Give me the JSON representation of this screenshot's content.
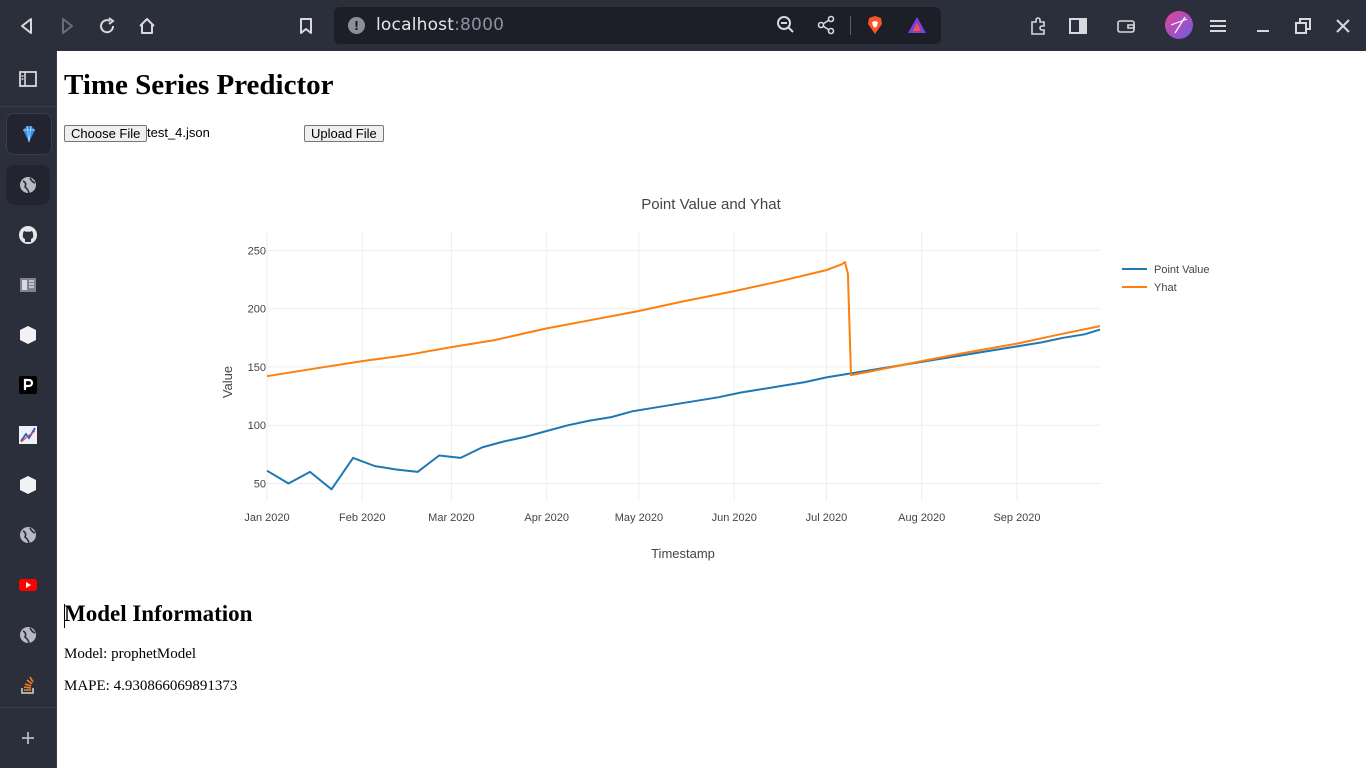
{
  "browser": {
    "url_host": "localhost",
    "url_port": ":8000"
  },
  "page": {
    "title": "Time Series Predictor",
    "choose_file_label": "Choose File",
    "file_name": "test_4.json",
    "upload_label": "Upload File"
  },
  "chart_data": {
    "type": "line",
    "title": "Point Value and Yhat",
    "xlabel": "Timestamp",
    "ylabel": "Value",
    "x_ticks": [
      "Jan 2020",
      "Feb 2020",
      "Mar 2020",
      "Apr 2020",
      "May 2020",
      "Jun 2020",
      "Jul 2020",
      "Aug 2020",
      "Sep 2020"
    ],
    "y_ticks": [
      50,
      100,
      150,
      200,
      250
    ],
    "x_range": [
      "2020-01-01",
      "2020-09-28"
    ],
    "y_range": [
      35,
      258
    ],
    "grid": true,
    "legend_position": "top-right",
    "series": [
      {
        "name": "Point Value",
        "color": "#1f77b4",
        "points": [
          [
            "2020-01-01",
            61
          ],
          [
            "2020-01-08",
            50
          ],
          [
            "2020-01-15",
            60
          ],
          [
            "2020-01-22",
            45
          ],
          [
            "2020-01-29",
            72
          ],
          [
            "2020-02-05",
            65
          ],
          [
            "2020-02-12",
            62
          ],
          [
            "2020-02-19",
            60
          ],
          [
            "2020-02-26",
            74
          ],
          [
            "2020-03-04",
            72
          ],
          [
            "2020-03-11",
            81
          ],
          [
            "2020-03-18",
            86
          ],
          [
            "2020-03-25",
            90
          ],
          [
            "2020-04-01",
            95
          ],
          [
            "2020-04-08",
            100
          ],
          [
            "2020-04-15",
            104
          ],
          [
            "2020-04-22",
            107
          ],
          [
            "2020-04-29",
            112
          ],
          [
            "2020-05-06",
            115
          ],
          [
            "2020-05-13",
            118
          ],
          [
            "2020-05-20",
            121
          ],
          [
            "2020-05-27",
            124
          ],
          [
            "2020-06-03",
            128
          ],
          [
            "2020-06-10",
            131
          ],
          [
            "2020-06-17",
            134
          ],
          [
            "2020-06-24",
            137
          ],
          [
            "2020-07-01",
            141
          ],
          [
            "2020-07-08",
            144
          ],
          [
            "2020-07-15",
            147
          ],
          [
            "2020-07-22",
            150
          ],
          [
            "2020-07-29",
            153
          ],
          [
            "2020-08-05",
            156
          ],
          [
            "2020-08-12",
            159
          ],
          [
            "2020-08-19",
            162
          ],
          [
            "2020-08-26",
            165
          ],
          [
            "2020-09-02",
            168
          ],
          [
            "2020-09-09",
            171
          ],
          [
            "2020-09-16",
            175
          ],
          [
            "2020-09-23",
            178
          ],
          [
            "2020-09-28",
            182
          ]
        ]
      },
      {
        "name": "Yhat",
        "color": "#ff7f0e",
        "points": [
          [
            "2020-01-01",
            142
          ],
          [
            "2020-01-15",
            148
          ],
          [
            "2020-02-01",
            155
          ],
          [
            "2020-02-15",
            160
          ],
          [
            "2020-03-01",
            167
          ],
          [
            "2020-03-15",
            173
          ],
          [
            "2020-04-01",
            183
          ],
          [
            "2020-04-15",
            190
          ],
          [
            "2020-05-01",
            198
          ],
          [
            "2020-05-15",
            206
          ],
          [
            "2020-06-01",
            215
          ],
          [
            "2020-06-15",
            223
          ],
          [
            "2020-07-01",
            233
          ],
          [
            "2020-07-06",
            238
          ],
          [
            "2020-07-07",
            240
          ],
          [
            "2020-07-08",
            230
          ],
          [
            "2020-07-09",
            143
          ],
          [
            "2020-07-15",
            146
          ],
          [
            "2020-08-01",
            155
          ],
          [
            "2020-08-15",
            162
          ],
          [
            "2020-09-01",
            170
          ],
          [
            "2020-09-15",
            178
          ],
          [
            "2020-09-28",
            185
          ]
        ]
      }
    ]
  },
  "model_info": {
    "heading": "Model Information",
    "model_line": "Model: prophetModel",
    "mape_line": "MAPE: 4.930866069891373"
  }
}
